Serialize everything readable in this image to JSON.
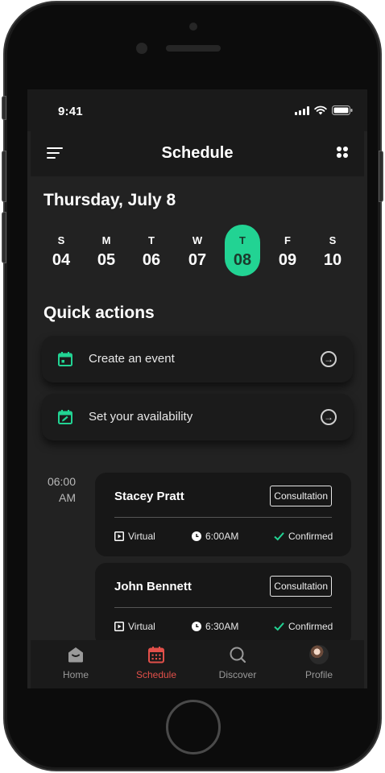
{
  "status_bar": {
    "time": "9:41"
  },
  "header": {
    "title": "Schedule"
  },
  "date_heading": "Thursday, July 8",
  "week": [
    {
      "letter": "S",
      "num": "04",
      "selected": false
    },
    {
      "letter": "M",
      "num": "05",
      "selected": false
    },
    {
      "letter": "T",
      "num": "06",
      "selected": false
    },
    {
      "letter": "W",
      "num": "07",
      "selected": false
    },
    {
      "letter": "T",
      "num": "08",
      "selected": true
    },
    {
      "letter": "F",
      "num": "09",
      "selected": false
    },
    {
      "letter": "S",
      "num": "10",
      "selected": false
    }
  ],
  "quick_actions": {
    "title": "Quick actions",
    "items": [
      {
        "label": "Create an event",
        "icon": "calendar-icon"
      },
      {
        "label": "Set your availability",
        "icon": "calendar-edit-icon"
      }
    ]
  },
  "timeline": {
    "time_label_line1": "06:00",
    "time_label_line2": "AM",
    "appointments": [
      {
        "name": "Stacey Pratt",
        "type": "Consultation",
        "mode": "Virtual",
        "time": "6:00AM",
        "status": "Confirmed"
      },
      {
        "name": "John Bennett",
        "type": "Consultation",
        "mode": "Virtual",
        "time": "6:30AM",
        "status": "Confirmed"
      }
    ]
  },
  "tab_bar": {
    "items": [
      {
        "label": "Home",
        "icon": "home-icon",
        "active": false
      },
      {
        "label": "Schedule",
        "icon": "calendar-icon",
        "active": true
      },
      {
        "label": "Discover",
        "icon": "search-icon",
        "active": false
      },
      {
        "label": "Profile",
        "icon": "avatar",
        "active": false
      }
    ]
  },
  "colors": {
    "accent": "#22d393",
    "active_tab": "#e2504a",
    "screen_bg": "#222222",
    "card_bg": "#1b1b1b"
  }
}
